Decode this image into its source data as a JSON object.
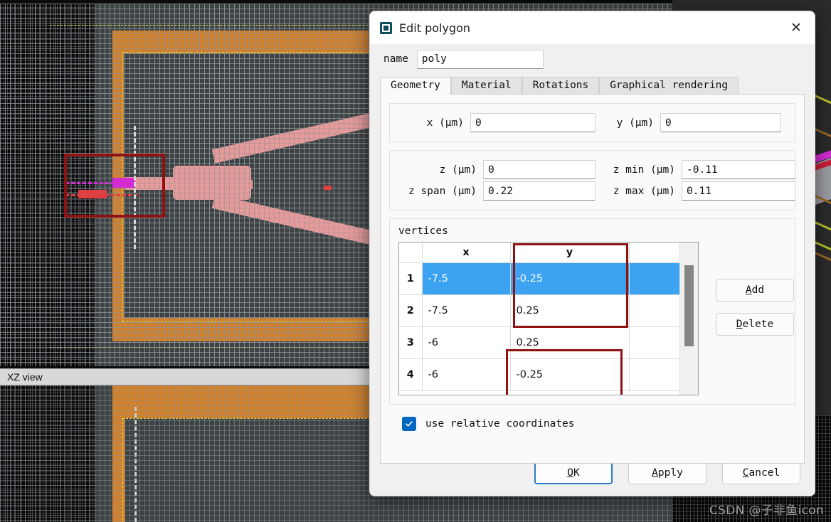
{
  "viewport": {
    "xz_panel_label": "XZ view",
    "watermark": "CSDN @子非鱼icon",
    "colors": {
      "mesh_bg": "#3d4244",
      "black_region": "#070707",
      "pml_orange": "#d2802a",
      "outline_yellow": "#e8e83a",
      "waveguide_pink": "#e79a9a",
      "source_magenta": "#d42ad4",
      "source_red": "#e04040",
      "monitor_white": "#d9dadb",
      "annotation_red": "#8f1111"
    }
  },
  "dialog": {
    "icon": "polygon-window-icon",
    "title": "Edit polygon",
    "close_label": "✕",
    "name_label": "name",
    "name_value": "poly",
    "tabs": [
      {
        "label": "Geometry",
        "active": true
      },
      {
        "label": "Material",
        "active": false
      },
      {
        "label": "Rotations",
        "active": false
      },
      {
        "label": "Graphical rendering",
        "active": false
      }
    ],
    "geometry": {
      "x_label": "x (μm)",
      "x_value": "0",
      "y_label": "y (μm)",
      "y_value": "0",
      "z_label": "z (μm)",
      "z_value": "0",
      "zmin_label": "z min (μm)",
      "zmin_value": "-0.11",
      "zspan_label": "z span (μm)",
      "zspan_value": "0.22",
      "zmax_label": "z max (μm)",
      "zmax_value": "0.11"
    },
    "vertices": {
      "title": "vertices",
      "columns": [
        "",
        "x",
        "y"
      ],
      "rows": [
        {
          "index": "1",
          "x": "-7.5",
          "y": "-0.25",
          "selected": true
        },
        {
          "index": "2",
          "x": "-7.5",
          "y": "0.25",
          "selected": false
        },
        {
          "index": "3",
          "x": "-6",
          "y": "0.25",
          "selected": false
        },
        {
          "index": "4",
          "x": "-6",
          "y": "-0.25",
          "selected": false
        }
      ],
      "add_label": "Add",
      "add_mnemonic": "A",
      "delete_label": "Delete",
      "delete_mnemonic": "D"
    },
    "relative_coords": {
      "label": "use relative coordinates",
      "checked": true
    },
    "footer": {
      "ok": "OK",
      "ok_mnemonic": "O",
      "apply": "Apply",
      "apply_mnemonic": "A",
      "cancel": "Cancel",
      "cancel_mnemonic": "C"
    }
  }
}
